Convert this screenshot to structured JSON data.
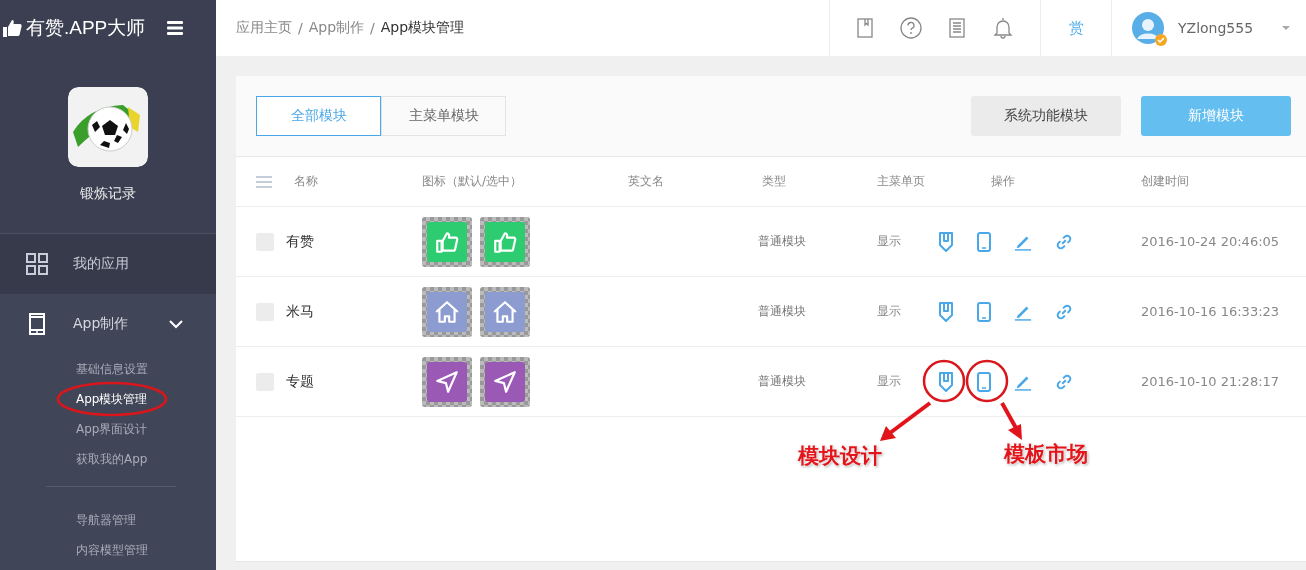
{
  "brand": {
    "name": "有赞.APP大师"
  },
  "breadcrumb": [
    {
      "label": "应用主页",
      "current": false
    },
    {
      "separator": "/",
      "label": "App制作",
      "current": false
    },
    {
      "separator": "/",
      "label": "App模块管理",
      "current": true
    }
  ],
  "header_tools": [
    {
      "kind": "book"
    },
    {
      "kind": "help"
    },
    {
      "kind": "doc"
    },
    {
      "kind": "bell"
    }
  ],
  "reward": {
    "label": "赏"
  },
  "user": {
    "name": "YZlong555",
    "verified": true
  },
  "app": {
    "name": "锻炼记录"
  },
  "nav": [
    {
      "label": "我的应用",
      "kind": "grid",
      "expanded": false
    },
    {
      "label": "App制作",
      "kind": "phone",
      "expanded": true,
      "child_groups": [
        {
          "items": [
            {
              "label": "基础信息设置",
              "selected": false
            },
            {
              "label": "App模块管理",
              "selected": true
            },
            {
              "label": "App界面设计",
              "selected": false
            },
            {
              "label": "获取我的App",
              "selected": false
            }
          ]
        },
        {
          "items": [
            {
              "label": "导航器管理",
              "selected": false
            },
            {
              "label": "内容模型管理",
              "selected": false
            }
          ]
        }
      ]
    }
  ],
  "tabs": [
    {
      "label": "全部模块",
      "selected": true
    },
    {
      "label": "主菜单模块",
      "selected": false
    }
  ],
  "buttons": [
    {
      "label": "系统功能模块",
      "kind": "secondary"
    },
    {
      "label": "新增模块",
      "kind": "primary"
    }
  ],
  "table": {
    "columns": [
      "名称",
      "图标（默认/选中）",
      "英文名",
      "类型",
      "主菜单页",
      "操作",
      "创建时间"
    ],
    "rows": [
      {
        "name": "有赞",
        "kind": "thumb",
        "color": "#2ecc71",
        "type": "普通模块",
        "menu": "显示",
        "created": "2016-10-24 20:46:05",
        "checked": false
      },
      {
        "name": "米马",
        "kind": "home",
        "color": "#8c9bd0",
        "type": "普通模块",
        "menu": "显示",
        "created": "2016-10-16 16:33:23",
        "checked": false
      },
      {
        "name": "专题",
        "kind": "send",
        "color": "#9b59b6",
        "type": "普通模块",
        "menu": "显示",
        "created": "2016-10-10 21:28:17",
        "checked": false
      }
    ]
  },
  "annotations": [
    {
      "label": "模块设计"
    },
    {
      "label": "模板市场"
    }
  ]
}
